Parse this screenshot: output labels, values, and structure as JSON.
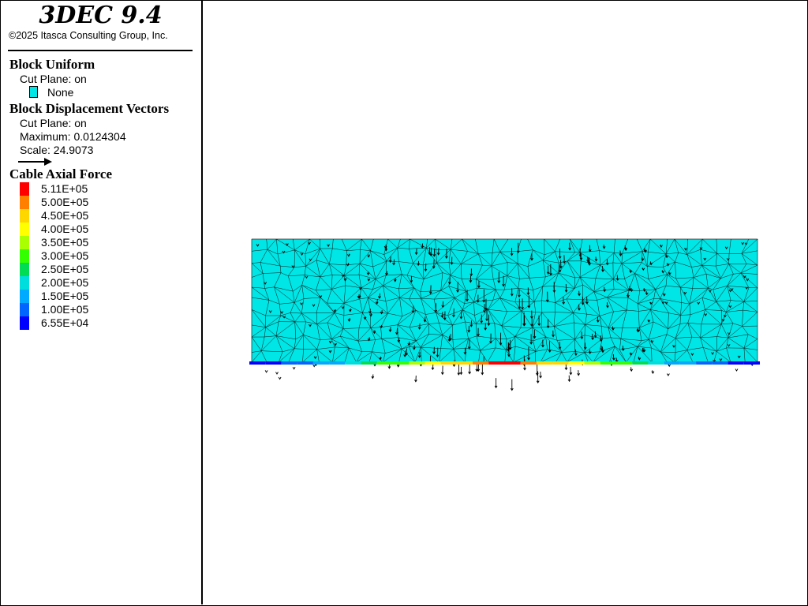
{
  "app": {
    "title": "3DEC 9.4",
    "copyright": "©2025 Itasca Consulting Group, Inc."
  },
  "legend": {
    "block": {
      "title": "Block  Uniform",
      "cut_plane": "Cut Plane: on",
      "swatch_label": "None",
      "swatch_color": "#00e5e5"
    },
    "vectors": {
      "title": "Block Displacement Vectors",
      "cut_plane": "Cut Plane: on",
      "maximum": "Maximum: 0.0124304",
      "scale": "Scale: 24.9073",
      "arrow_icon": "arrow-right-icon"
    },
    "cable": {
      "title": "Cable Axial Force",
      "entries": [
        {
          "label": "5.11E+05",
          "color": "#ff0000"
        },
        {
          "label": "5.00E+05",
          "color": "#ff7f00"
        },
        {
          "label": "4.50E+05",
          "color": "#ffd700"
        },
        {
          "label": "4.00E+05",
          "color": "#ffff00"
        },
        {
          "label": "3.50E+05",
          "color": "#aaff00"
        },
        {
          "label": "3.00E+05",
          "color": "#33ff00"
        },
        {
          "label": "2.50E+05",
          "color": "#00dd55"
        },
        {
          "label": "2.00E+05",
          "color": "#00dddd"
        },
        {
          "label": "1.50E+05",
          "color": "#00aaff"
        },
        {
          "label": "1.00E+05",
          "color": "#0066ff"
        },
        {
          "label": "6.55E+04",
          "color": "#0000ff"
        }
      ]
    }
  },
  "viewport": {
    "block_color": "#00e5e5",
    "mesh_color": "#000000",
    "vector_color": "#000000"
  }
}
